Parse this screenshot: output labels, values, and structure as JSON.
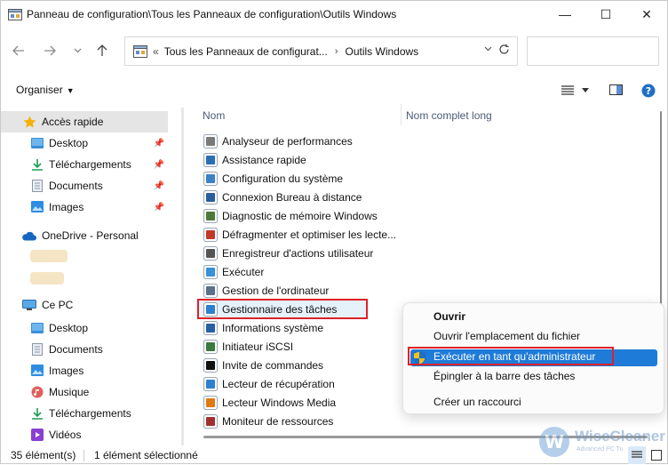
{
  "window": {
    "title": "Panneau de configuration\\Tous les Panneaux de configuration\\Outils Windows",
    "minimize_glyph": "—",
    "maximize_glyph": "☐",
    "close_glyph": "✕"
  },
  "address": {
    "separator": "«",
    "segment1": "Tous les Panneaux de configurat...",
    "chevron": "›",
    "segment2": "Outils Windows"
  },
  "toolbar": {
    "organiser_label": "Organiser"
  },
  "sidebar": {
    "items": [
      {
        "label": "Accès rapide"
      },
      {
        "label": "Desktop"
      },
      {
        "label": "Téléchargements"
      },
      {
        "label": "Documents"
      },
      {
        "label": "Images"
      },
      {
        "label": "OneDrive - Personal"
      },
      {
        "label": "Ce PC"
      },
      {
        "label": "Desktop"
      },
      {
        "label": "Documents"
      },
      {
        "label": "Images"
      },
      {
        "label": "Musique"
      },
      {
        "label": "Téléchargements"
      },
      {
        "label": "Vidéos"
      }
    ]
  },
  "columns": {
    "name": "Nom",
    "full_name": "Nom complet long"
  },
  "files": [
    {
      "name": "Analyseur de performances",
      "color": "#7a7a7a"
    },
    {
      "name": "Assistance rapide",
      "color": "#2a6fb5"
    },
    {
      "name": "Configuration du système",
      "color": "#3c82c7"
    },
    {
      "name": "Connexion Bureau à distance",
      "color": "#2b5e9e"
    },
    {
      "name": "Diagnostic de mémoire Windows",
      "color": "#4d7a3a"
    },
    {
      "name": "Défragmenter et optimiser les lecte...",
      "color": "#c0392b"
    },
    {
      "name": "Enregistreur d'actions utilisateur",
      "color": "#555555"
    },
    {
      "name": "Exécuter",
      "color": "#3a8fd6"
    },
    {
      "name": "Gestion de l'ordinateur",
      "color": "#5a6f8a"
    },
    {
      "name": "Gestionnaire des tâches",
      "color": "#2f7fd0"
    },
    {
      "name": "Informations système",
      "color": "#2a5fa5"
    },
    {
      "name": "Initiateur iSCSI",
      "color": "#3b7a3e"
    },
    {
      "name": "Invite de commandes",
      "color": "#111111"
    },
    {
      "name": "Lecteur de récupération",
      "color": "#2f7fd0"
    },
    {
      "name": "Lecteur Windows Media",
      "color": "#e07a12"
    },
    {
      "name": "Moniteur de ressources",
      "color": "#a03030"
    }
  ],
  "context_menu": {
    "items": [
      {
        "label": "Ouvrir"
      },
      {
        "label": "Ouvrir l'emplacement du fichier"
      },
      {
        "label": "Exécuter en tant qu'administrateur"
      },
      {
        "label": "Épingler à la barre des tâches"
      },
      {
        "label": "Créer un raccourci"
      }
    ]
  },
  "status": {
    "count": "35 élément(s)",
    "selection": "1 élément sélectionné"
  },
  "watermark": {
    "brand": "WiseCleaner",
    "tagline": "Advanced PC Tu"
  },
  "colors": {
    "accent": "#1e7bd8",
    "highlight_box": "#e0202a",
    "selected_row": "#e5f1fb"
  }
}
